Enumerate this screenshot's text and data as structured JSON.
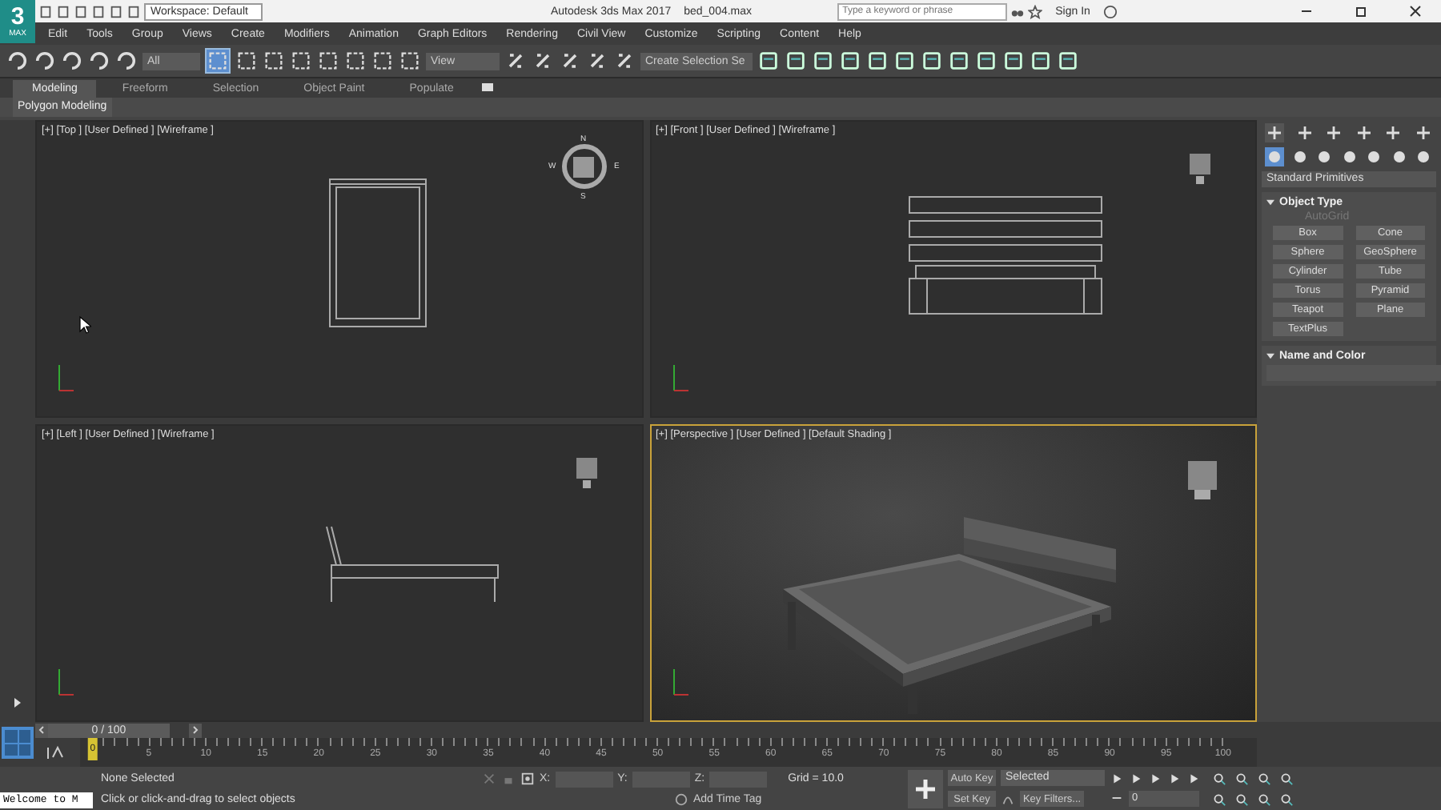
{
  "title_bar": {
    "logo": {
      "numeral": "3",
      "caption": "MAX"
    },
    "workspace": "Workspace: Default",
    "app_title": "Autodesk 3ds Max 2017",
    "file_name": "bed_004.max",
    "search": {
      "placeholder": "Type a keyword or phrase"
    },
    "sign_in": "Sign In"
  },
  "menu": [
    "Edit",
    "Tools",
    "Group",
    "Views",
    "Create",
    "Modifiers",
    "Animation",
    "Graph Editors",
    "Rendering",
    "Civil View",
    "Customize",
    "Scripting",
    "Content",
    "Help"
  ],
  "toolbar": {
    "selection_filter": "All",
    "reference_coordinates": "View",
    "named_selection": "Create Selection Se"
  },
  "ribbon": {
    "tabs": [
      {
        "label": "Modeling",
        "selected": true
      },
      {
        "label": "Freeform",
        "selected": false
      },
      {
        "label": "Selection",
        "selected": false
      },
      {
        "label": "Object Paint",
        "selected": false
      },
      {
        "label": "Populate",
        "selected": false
      }
    ],
    "panel": "Polygon Modeling"
  },
  "viewports": [
    {
      "label": "[+] [Top ] [User Defined ] [Wireframe ]",
      "kind": "top",
      "active": false,
      "compass": [
        "N",
        "W",
        "E",
        "S"
      ]
    },
    {
      "label": "[+] [Front ] [User Defined ] [Wireframe ]",
      "kind": "front",
      "active": false
    },
    {
      "label": "[+] [Left ] [User Defined ] [Wireframe ]",
      "kind": "left",
      "active": false
    },
    {
      "label": "[+] [Perspective ] [User Defined ] [Default Shading ]",
      "kind": "perspective",
      "active": true
    }
  ],
  "command_panel": {
    "dropdown": "Standard Primitives",
    "object_type": {
      "title": "Object Type",
      "expanded": true,
      "autogrid": {
        "label": "AutoGrid",
        "disabled": true
      },
      "buttons": [
        "Box",
        "Cone",
        "Sphere",
        "GeoSphere",
        "Cylinder",
        "Tube",
        "Torus",
        "Pyramid",
        "Teapot",
        "Plane",
        "TextPlus"
      ]
    },
    "name_and_color": {
      "title": "Name and Color",
      "expanded": true
    }
  },
  "timeline": {
    "frame_counter": "0 / 100",
    "level": 0,
    "ticks": [
      "0",
      "5",
      "10",
      "15",
      "20",
      "25",
      "30",
      "35",
      "40",
      "45",
      "50",
      "55",
      "60",
      "65",
      "70",
      "75",
      "80",
      "85",
      "90",
      "95",
      "100"
    ]
  },
  "status_bar": {
    "listener": "Welcome to M",
    "selection": "None Selected",
    "prompt": "Click or click-and-drag to select objects",
    "x_label": "X:",
    "y_label": "Y:",
    "z_label": "Z:",
    "grid": "Grid = 10.0",
    "time_tag": "Add Time Tag",
    "auto_key": "Auto Key",
    "set_key": "Set Key",
    "key_mode": "Selected",
    "key_filters": "Key Filters...",
    "current_frame": "0"
  }
}
